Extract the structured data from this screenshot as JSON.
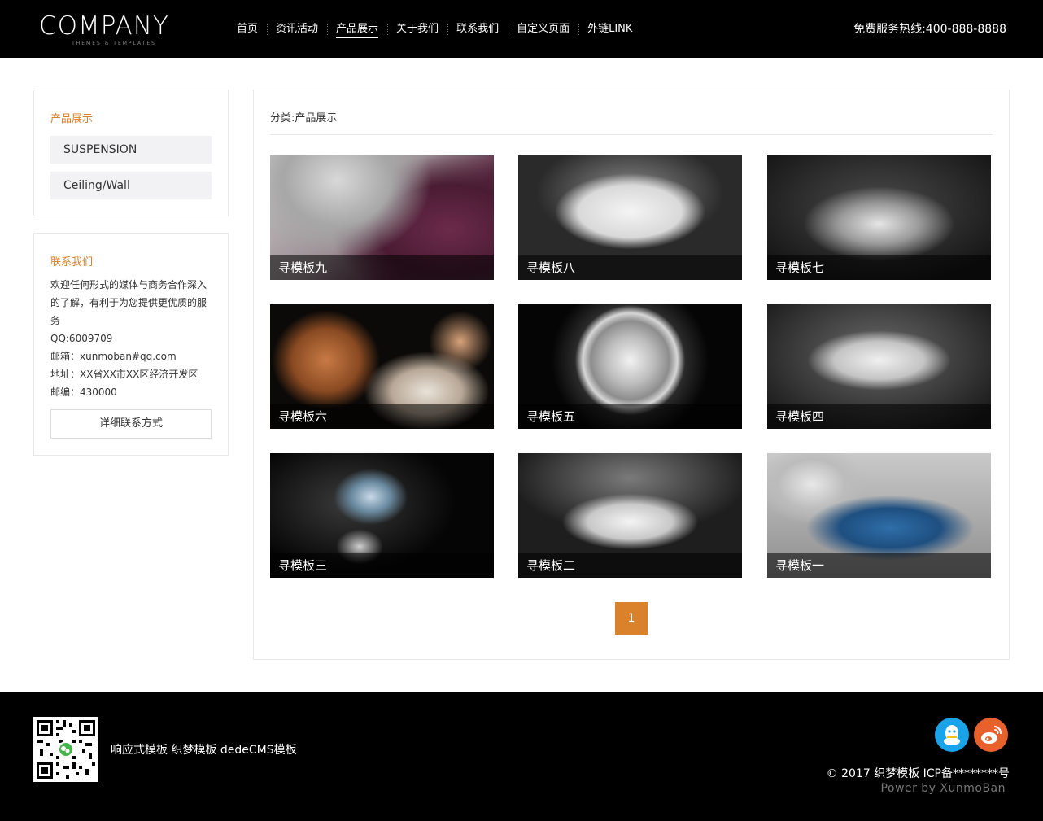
{
  "header": {
    "logo_main": "COMPANY",
    "logo_sub": "THEMES & TEMPLATES",
    "nav": [
      "首页",
      "资讯活动",
      "产品展示",
      "关于我们",
      "联系我们",
      "自定义页面",
      "外链LINK"
    ],
    "active_index": 2,
    "hotline": "免费服务热线:400-888-8888"
  },
  "sidebar": {
    "categories_title": "产品展示",
    "categories": [
      "SUSPENSION",
      "Ceiling/Wall"
    ],
    "contact_title": "联系我们",
    "contact_lines": [
      "欢迎任何形式的媒体与商务合作深入的了解，有利于为您提供更优质的服务",
      "QQ:6009709",
      "邮箱：xunmoban#qq.com",
      "地址：XX省XX市XX区经济开发区",
      "邮编：430000"
    ],
    "contact_button": "详细联系方式"
  },
  "main": {
    "breadcrumb": "分类:产品展示",
    "products": [
      "寻模板九",
      "寻模板八",
      "寻模板七",
      "寻模板六",
      "寻模板五",
      "寻模板四",
      "寻模板三",
      "寻模板二",
      "寻模板一"
    ],
    "page": "1"
  },
  "footer": {
    "links": "响应式模板 织梦模板 dedeCMS模板",
    "copyright": "© 2017 织梦模板 ICP备********号",
    "power": "Power by XunmoBan"
  },
  "colors": {
    "accent": "#d9822b",
    "header_bg": "#000000",
    "qq": "#1aa3e8",
    "weibo": "#e8612c"
  }
}
